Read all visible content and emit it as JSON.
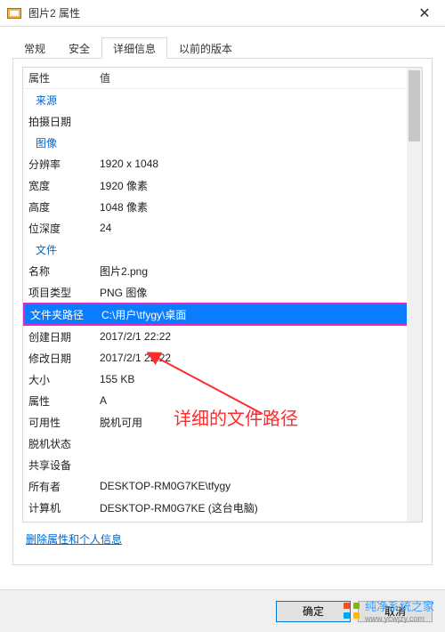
{
  "window": {
    "title": "图片2 属性"
  },
  "tabs": {
    "t0": "常规",
    "t1": "安全",
    "t2": "详细信息",
    "t3": "以前的版本"
  },
  "headers": {
    "prop": "属性",
    "val": "值"
  },
  "sections": {
    "source": "来源",
    "image": "图像",
    "file": "文件"
  },
  "rows": {
    "shot_label": "拍摄日期",
    "shot_val": "",
    "res_label": "分辨率",
    "res_val": "1920 x 1048",
    "w_label": "宽度",
    "w_val": "1920 像素",
    "h_label": "高度",
    "h_val": "1048 像素",
    "depth_label": "位深度",
    "depth_val": "24",
    "name_label": "名称",
    "name_val": "图片2.png",
    "type_label": "项目类型",
    "type_val": "PNG 图像",
    "path_label": "文件夹路径",
    "path_val": "C:\\用户\\tfygy\\桌面",
    "created_label": "创建日期",
    "created_val": "2017/2/1 22:22",
    "modified_label": "修改日期",
    "modified_val": "2017/2/1 22:22",
    "size_label": "大小",
    "size_val": "155 KB",
    "attr_label": "属性",
    "attr_val": "A",
    "avail_label": "可用性",
    "avail_val": "脱机可用",
    "offline_label": "脱机状态",
    "offline_val": "",
    "shared_label": "共享设备",
    "shared_val": "",
    "owner_label": "所有者",
    "owner_val": "DESKTOP-RM0G7KE\\tfygy",
    "pc_label": "计算机",
    "pc_val": "DESKTOP-RM0G7KE (这台电脑)"
  },
  "link": {
    "remove": "删除属性和个人信息"
  },
  "buttons": {
    "ok": "确定",
    "cancel": "取消"
  },
  "annotation": {
    "text": "详细的文件路径"
  },
  "watermark": {
    "text": "纯净系统之家",
    "url": "www.ycwjzy.com"
  },
  "colors": {
    "highlight": "#0a7cff",
    "highlight_border": "#e028c4",
    "link": "#0066cc",
    "anno": "#ff2a2e"
  }
}
